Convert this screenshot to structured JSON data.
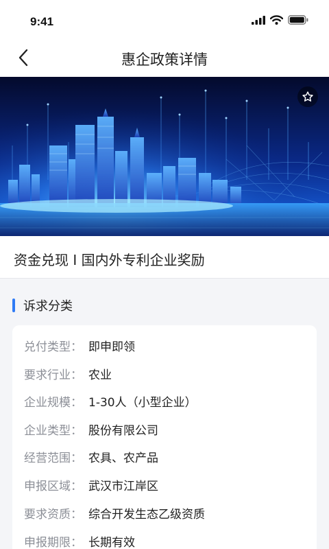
{
  "status_bar": {
    "time": "9:41"
  },
  "nav": {
    "title": "惠企政策详情"
  },
  "policy": {
    "title": "资金兑现 I 国内外专利企业奖励"
  },
  "section": {
    "title": "诉求分类"
  },
  "details": [
    {
      "label": "兑付类型：",
      "value": "即申即领"
    },
    {
      "label": "要求行业：",
      "value": "农业"
    },
    {
      "label": "企业规模：",
      "value": "1-30人（小型企业）"
    },
    {
      "label": "企业类型：",
      "value": "股份有限公司"
    },
    {
      "label": "经营范围：",
      "value": "农具、农产品"
    },
    {
      "label": "申报区域：",
      "value": "武汉市江岸区"
    },
    {
      "label": "要求资质：",
      "value": "综合开发生态乙级资质"
    },
    {
      "label": "申报期限：",
      "value": "长期有效"
    }
  ],
  "icons": {
    "back": "chevron-left-icon",
    "favorite": "star-outline-icon",
    "signal": "cellular-signal-icon",
    "wifi": "wifi-icon",
    "battery": "battery-icon"
  },
  "colors": {
    "accent": "#2f7bf5",
    "label": "#8c8f97",
    "text": "#222222",
    "page_background": "#f4f5f8"
  }
}
